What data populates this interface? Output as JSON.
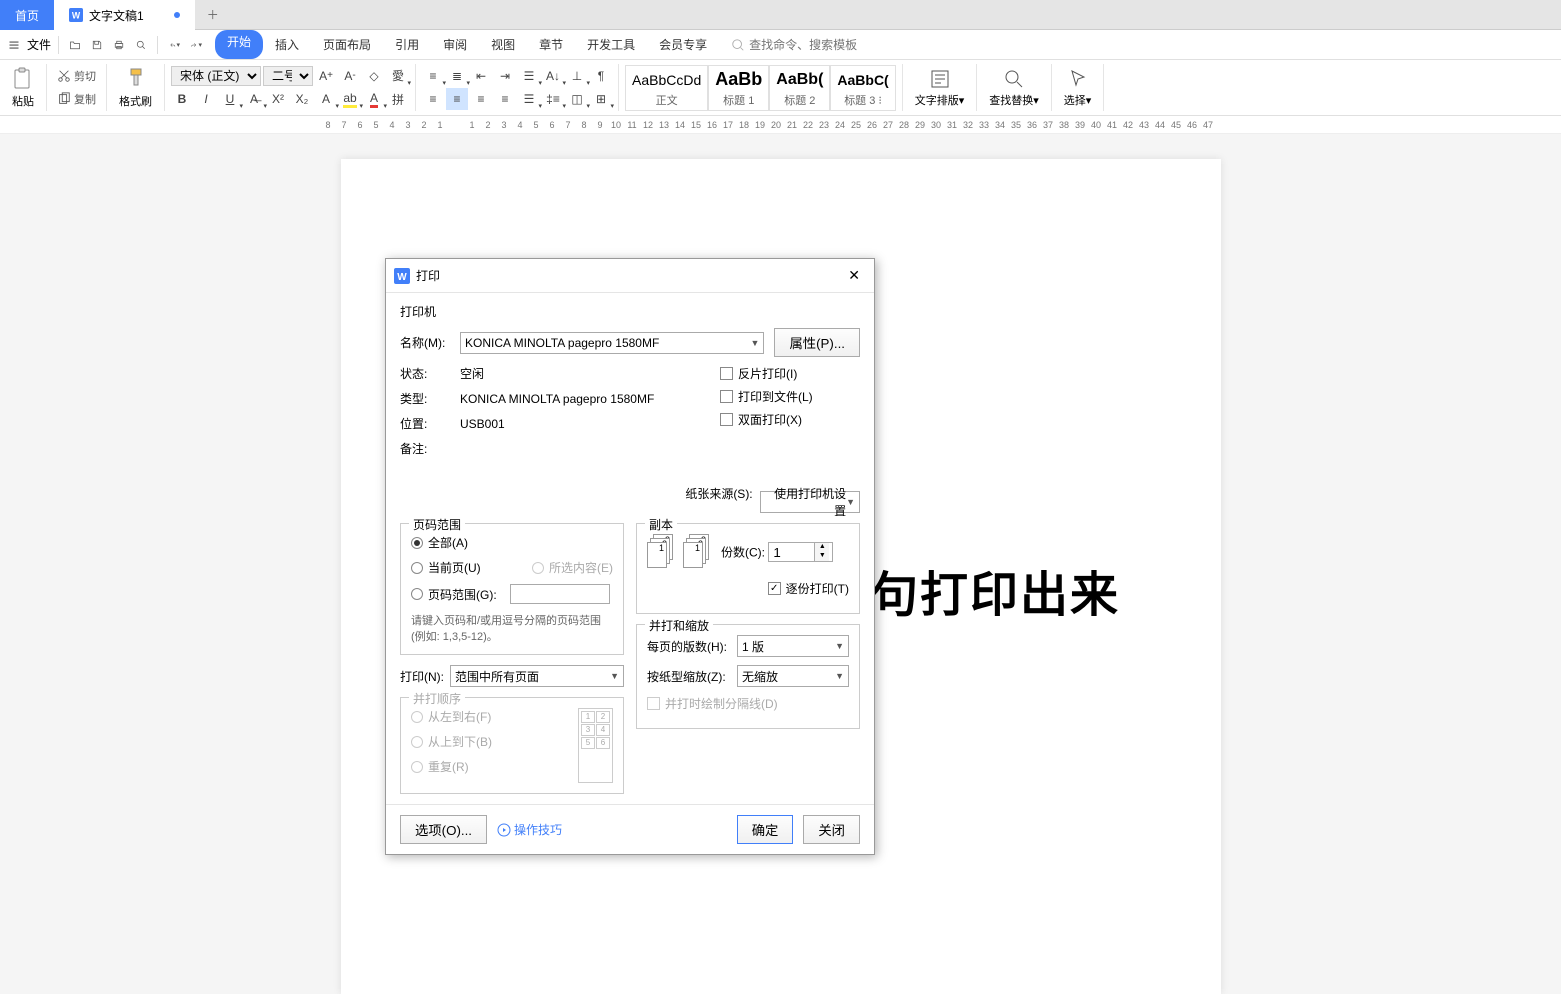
{
  "tabs": {
    "home": "首页",
    "doc": "文字文稿1"
  },
  "menu": {
    "file": "文件",
    "items": [
      "开始",
      "插入",
      "页面布局",
      "引用",
      "审阅",
      "视图",
      "章节",
      "开发工具",
      "会员专享"
    ],
    "search_placeholder": "查找命令、搜索模板"
  },
  "ribbon": {
    "paste": "粘贴",
    "cut": "剪切",
    "copy": "复制",
    "format_painter": "格式刷",
    "font_name": "宋体 (正文)",
    "font_size": "二号",
    "styles": [
      {
        "preview": "AaBbCcDd",
        "name": "正文"
      },
      {
        "preview": "AaBb",
        "name": "标题 1"
      },
      {
        "preview": "AaBb(",
        "name": "标题 2"
      },
      {
        "preview": "AaBbC(",
        "name": "标题 3"
      }
    ],
    "text_layout": "文字排版",
    "find_replace": "查找替换",
    "select": "选择"
  },
  "ruler_ticks": [
    "8",
    "7",
    "6",
    "5",
    "4",
    "3",
    "2",
    "1",
    "",
    "1",
    "2",
    "3",
    "4",
    "5",
    "6",
    "7",
    "8",
    "9",
    "10",
    "11",
    "12",
    "13",
    "14",
    "15",
    "16",
    "17",
    "18",
    "19",
    "20",
    "21",
    "22",
    "23",
    "24",
    "25",
    "26",
    "27",
    "28",
    "29",
    "30",
    "31",
    "32",
    "33",
    "34",
    "35",
    "36",
    "37",
    "38",
    "39",
    "40",
    "41",
    "42",
    "43",
    "44",
    "45",
    "46",
    "47"
  ],
  "document_text": "句打印出来",
  "dialog": {
    "title": "打印",
    "printer_section": "打印机",
    "name_label": "名称(M):",
    "name_value": "KONICA MINOLTA pagepro 1580MF",
    "properties_btn": "属性(P)...",
    "status_label": "状态:",
    "status_value": "空闲",
    "type_label": "类型:",
    "type_value": "KONICA MINOLTA pagepro 1580MF",
    "location_label": "位置:",
    "location_value": "USB001",
    "comment_label": "备注:",
    "reverse_print": "反片打印(I)",
    "print_to_file": "打印到文件(L)",
    "duplex": "双面打印(X)",
    "paper_source_label": "纸张来源(S):",
    "paper_source_value": "使用打印机设置",
    "page_range_title": "页码范围",
    "range_all": "全部(A)",
    "range_current": "当前页(U)",
    "range_selection": "所选内容(E)",
    "range_pages": "页码范围(G):",
    "range_hint": "请键入页码和/或用逗号分隔的页码范围(例如: 1,3,5-12)。",
    "copies_title": "副本",
    "copies_label": "份数(C):",
    "copies_value": "1",
    "collate": "逐份打印(T)",
    "print_what_label": "打印(N):",
    "print_what_value": "范围中所有页面",
    "order_title": "并打顺序",
    "order_lr": "从左到右(F)",
    "order_tb": "从上到下(B)",
    "order_repeat": "重复(R)",
    "zoom_title": "并打和缩放",
    "pages_per_sheet_label": "每页的版数(H):",
    "pages_per_sheet_value": "1 版",
    "scale_label": "按纸型缩放(Z):",
    "scale_value": "无缩放",
    "draw_borders": "并打时绘制分隔线(D)",
    "options_btn": "选项(O)...",
    "tips": "操作技巧",
    "ok": "确定",
    "close": "关闭"
  }
}
